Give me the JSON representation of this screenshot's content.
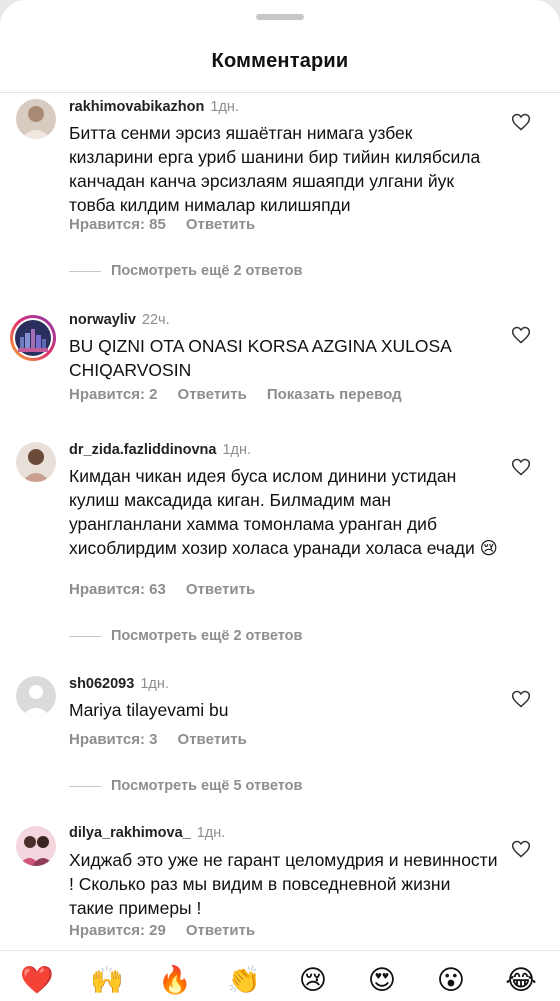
{
  "header": {
    "title": "Комментарии"
  },
  "comments": [
    {
      "username": "rakhimovabikazhon",
      "time": "1дн.",
      "text": "Битта сенми эрсиз яшаётган нимага узбек кизларини ерга уриб шанини бир тийин килябсила канчадан канча эрсизлаям яшаяпди улгани йук товба килдим нималар килишяпди",
      "likes": "Нравится: 85",
      "reply": "Ответить",
      "more_replies": "Посмотреть ещё 2 ответов"
    },
    {
      "username": "norwayliv",
      "time": "22ч.",
      "text": "BU QIZNI OTA ONASI KORSA AZGINA XULOSA CHIQARVOSIN",
      "likes": "Нравится: 2",
      "reply": "Ответить",
      "translate": "Показать перевод"
    },
    {
      "username": "dr_zida.fazliddinovna",
      "time": "1дн.",
      "text": "Кимдан чикан идея буса ислом динини устидан кулиш максадида киган. Билмадим ман урангланлани хамма томонлама уранган диб хисоблирдим хозир холаса уранади холаса ечади 😢",
      "likes": "Нравится: 63",
      "reply": "Ответить",
      "more_replies": "Посмотреть ещё 2 ответов"
    },
    {
      "username": "sh062093",
      "time": "1дн.",
      "text": "Mariya tilayevami bu",
      "likes": "Нравится: 3",
      "reply": "Ответить",
      "more_replies": "Посмотреть ещё 5 ответов"
    },
    {
      "username": "dilya_rakhimova_",
      "time": "1дн.",
      "text": "Хиджаб это уже не гарант целомудрия и невинности ! Сколько раз мы видим в повседневной жизни такие примеры !",
      "likes": "Нравится: 29",
      "reply": "Ответить"
    }
  ],
  "emoji_bar": [
    "❤️",
    "🙌",
    "🔥",
    "👏",
    "😢",
    "😍",
    "😮",
    "😂"
  ],
  "colors": {
    "muted": "#8e8e8e",
    "heart_red": "#ed4956"
  }
}
